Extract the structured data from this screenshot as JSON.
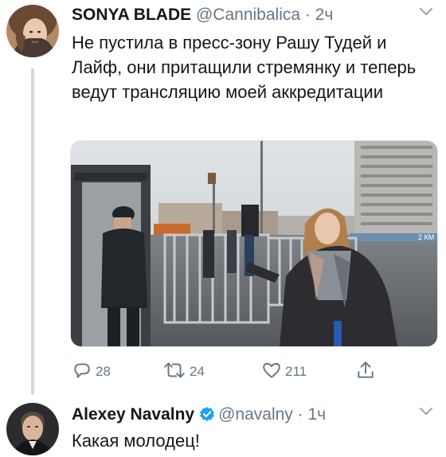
{
  "tweets": [
    {
      "name": "SONYA BLADE",
      "handle": "@Cannibalica",
      "separator": "·",
      "time": "2ч",
      "text": "Не пустила в пресс-зону Рашу Тудей и Лайф, они притащили стремянку и теперь ведут трансляцию моей аккредитации",
      "actions": {
        "replies": "28",
        "retweets": "24",
        "likes": "211"
      }
    },
    {
      "name": "Alexey Navalny",
      "handle": "@navalny",
      "separator": "·",
      "time": "1ч",
      "text": "Какая молодец!",
      "verified": true
    }
  ],
  "media": {
    "sign_text": "2 КМ"
  },
  "colors": {
    "text": "#14171a",
    "secondary": "#657786",
    "verified": "#1da1f2",
    "thread_line": "#cfd9de"
  },
  "icons": [
    "reply-icon",
    "retweet-icon",
    "like-icon",
    "share-icon",
    "chevron-down-icon",
    "verified-badge-icon"
  ]
}
